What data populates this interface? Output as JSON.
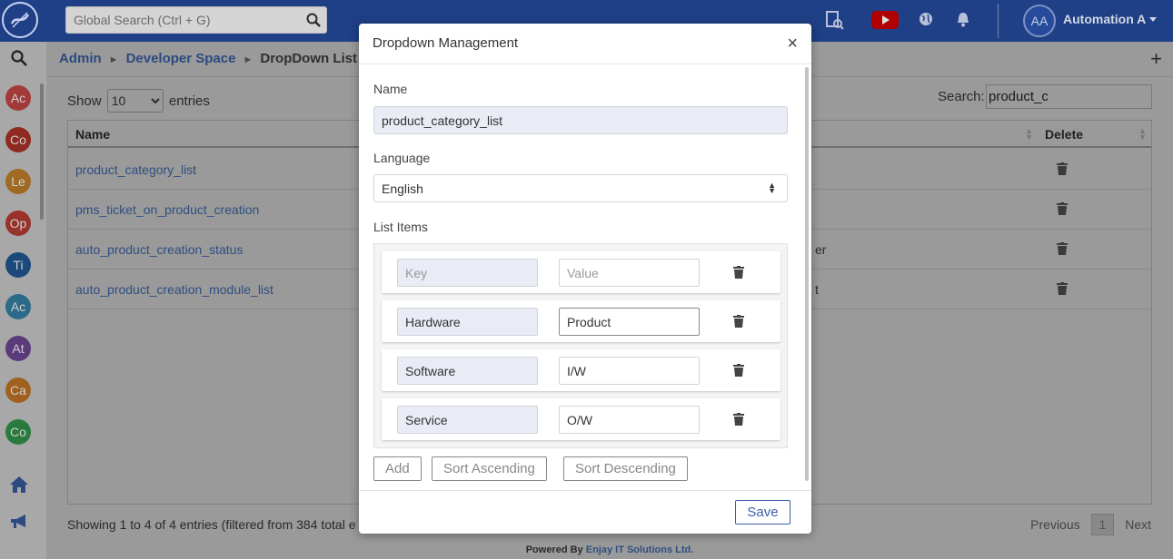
{
  "topbar": {
    "search_placeholder": "Global Search (Ctrl + G)",
    "user_initials": "AA",
    "user_name": "Automation A"
  },
  "sidebar": {
    "items": [
      {
        "label": "Ac",
        "color": "#a33a3a"
      },
      {
        "label": "Co",
        "color": "#8f2a20"
      },
      {
        "label": "Le",
        "color": "#a06a23"
      },
      {
        "label": "Op",
        "color": "#98322a"
      },
      {
        "label": "Ti",
        "color": "#1b4a7a"
      },
      {
        "label": "Ac",
        "color": "#2c6a8a"
      },
      {
        "label": "At",
        "color": "#5a3a7a"
      },
      {
        "label": "Ca",
        "color": "#a0601e"
      },
      {
        "label": "Co",
        "color": "#2a7a3e"
      }
    ]
  },
  "breadcrumb": {
    "admin": "Admin",
    "developer_space": "Developer Space",
    "current": "DropDown List"
  },
  "table_controls": {
    "show": "Show",
    "entries_value": "10",
    "entries": "entries",
    "search_label": "Search:",
    "search_value": "product_c"
  },
  "table": {
    "columns": {
      "name": "Name",
      "delete": "Delete"
    },
    "rows": [
      {
        "name": "product_category_list",
        "mid": ""
      },
      {
        "name": "pms_ticket_on_product_creation",
        "mid": ""
      },
      {
        "name": "auto_product_creation_status",
        "mid": "er"
      },
      {
        "name": "auto_product_creation_module_list",
        "mid": "t"
      }
    ]
  },
  "pagination": {
    "showing": "Showing 1 to 4 of 4 entries (filtered from 384 total e",
    "previous": "Previous",
    "page": "1",
    "next": "Next"
  },
  "footer": {
    "powered": "Powered By ",
    "company": "Enjay IT Solutions Ltd."
  },
  "modal": {
    "title": "Dropdown Management",
    "close": "×",
    "name_label": "Name",
    "name_value": "product_category_list",
    "language_label": "Language",
    "language_value": "English",
    "list_items_label": "List Items",
    "key_placeholder": "Key",
    "value_placeholder": "Value",
    "items": [
      {
        "key": "",
        "value": ""
      },
      {
        "key": "Hardware",
        "value": "Product"
      },
      {
        "key": "Software",
        "value": "I/W"
      },
      {
        "key": "Service",
        "value": "O/W"
      }
    ],
    "add_label": "Add",
    "sort_asc_label": "Sort Ascending",
    "sort_desc_label": "Sort Descending",
    "save_label": "Save"
  }
}
